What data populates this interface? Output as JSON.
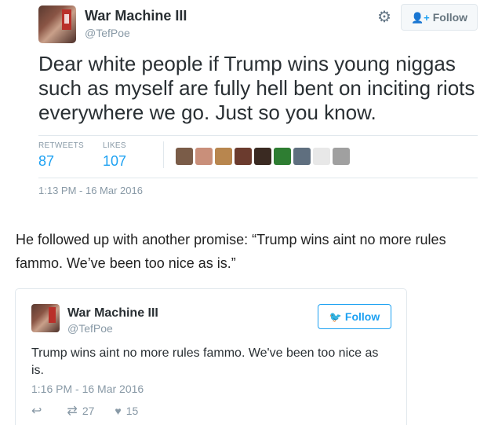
{
  "tweet1": {
    "display_name": "War Machine III",
    "handle": "@TefPoe",
    "follow_label": "Follow",
    "text": "Dear white people if Trump wins young niggas such as myself are fully hell bent on inciting riots everywhere we go. Just so you know.",
    "retweets_label": "RETWEETS",
    "retweets_count": "87",
    "likes_label": "LIKES",
    "likes_count": "107",
    "timestamp": "1:13 PM - 16 Mar 2016",
    "liker_colors": [
      "#7a5c48",
      "#c98f7a",
      "#b8864e",
      "#6b3b2e",
      "#3a2a22",
      "#2e7d32",
      "#5f6f7f",
      "#e8e8e8",
      "#a0a0a0"
    ]
  },
  "article": {
    "paragraph": "He followed up with another promise: “Trump wins aint no more rules fammo. We’ve been too nice as is.”"
  },
  "tweet2": {
    "display_name": "War Machine III",
    "handle": "@TefPoe",
    "follow_label": "Follow",
    "text": "Trump wins aint no more rules fammo. We've been too nice as is.",
    "timestamp": "1:16 PM - 16 Mar 2016",
    "retweet_count": "27",
    "like_count": "15"
  },
  "colors": {
    "accent": "#1da1f2",
    "muted": "#8899a6",
    "text": "#292f33",
    "border": "#e1e8ed"
  }
}
